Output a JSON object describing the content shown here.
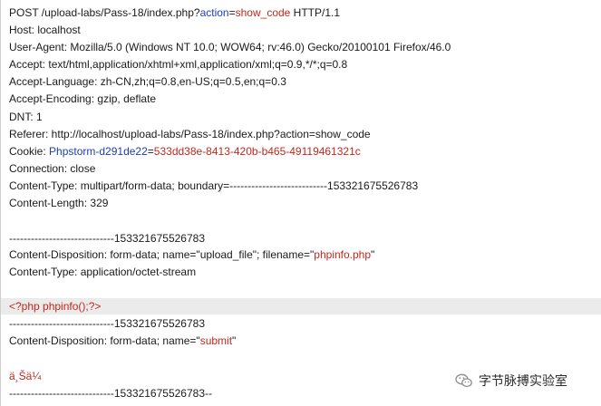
{
  "request": {
    "line1": {
      "a": "POST /upload-labs/Pass-18/index.php?",
      "b": "action",
      "c": "=",
      "d": "show_code",
      "e": " HTTP/1.1"
    },
    "host": "Host: localhost",
    "user_agent": "User-Agent: Mozilla/5.0 (Windows NT 10.0; WOW64; rv:46.0) Gecko/20100101 Firefox/46.0",
    "accept": "Accept: text/html,application/xhtml+xml,application/xml;q=0.9,*/*;q=0.8",
    "accept_language": "Accept-Language: zh-CN,zh;q=0.8,en-US;q=0.5,en;q=0.3",
    "accept_encoding": "Accept-Encoding: gzip, deflate",
    "dnt": "DNT: 1",
    "referer": "Referer: http://localhost/upload-labs/Pass-18/index.php?action=show_code",
    "cookie": {
      "label": "Cookie: ",
      "name": "Phpstorm-d291de22",
      "eq": "=",
      "value": "533dd38e-8413-420b-b465-49119461321c"
    },
    "connection": "Connection: close",
    "content_type": "Content-Type: multipart/form-data; boundary=---------------------------153321675526783",
    "content_length": "Content-Length: 329"
  },
  "body": {
    "boundary1": "-----------------------------153321675526783",
    "disposition1": {
      "a": "Content-Disposition: form-data; name=\"upload_file\"; filename=\"",
      "b": "phpinfo.php",
      "c": "\""
    },
    "content_type": "Content-Type: application/octet-stream",
    "php_code": "<?php phpinfo();?>",
    "boundary2": "-----------------------------153321675526783",
    "disposition2": {
      "a": "Content-Disposition: form-data; name=\"",
      "b": "submit",
      "c": "\""
    },
    "submit_value": "ä¸Šä¼ ",
    "boundary_end": "-----------------------------153321675526783--"
  },
  "watermark": {
    "icon": "wechat-icon",
    "text": "字节脉搏实验室"
  },
  "colors": {
    "param": "#1c3fae",
    "value": "#c1281c",
    "highlight_bg": "#ebebeb"
  }
}
